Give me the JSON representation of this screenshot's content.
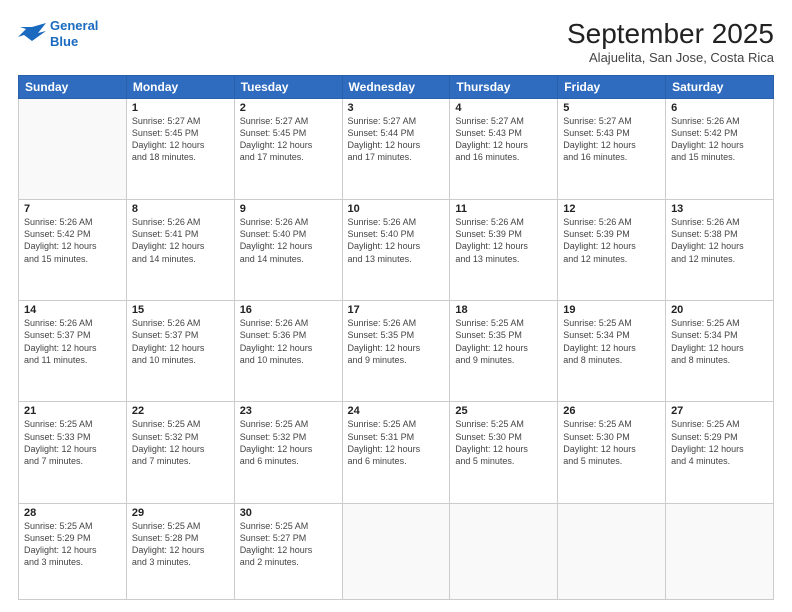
{
  "logo": {
    "line1": "General",
    "line2": "Blue"
  },
  "title": "September 2025",
  "subtitle": "Alajuelita, San Jose, Costa Rica",
  "weekdays": [
    "Sunday",
    "Monday",
    "Tuesday",
    "Wednesday",
    "Thursday",
    "Friday",
    "Saturday"
  ],
  "weeks": [
    [
      {
        "day": "",
        "info": ""
      },
      {
        "day": "1",
        "info": "Sunrise: 5:27 AM\nSunset: 5:45 PM\nDaylight: 12 hours\nand 18 minutes."
      },
      {
        "day": "2",
        "info": "Sunrise: 5:27 AM\nSunset: 5:45 PM\nDaylight: 12 hours\nand 17 minutes."
      },
      {
        "day": "3",
        "info": "Sunrise: 5:27 AM\nSunset: 5:44 PM\nDaylight: 12 hours\nand 17 minutes."
      },
      {
        "day": "4",
        "info": "Sunrise: 5:27 AM\nSunset: 5:43 PM\nDaylight: 12 hours\nand 16 minutes."
      },
      {
        "day": "5",
        "info": "Sunrise: 5:27 AM\nSunset: 5:43 PM\nDaylight: 12 hours\nand 16 minutes."
      },
      {
        "day": "6",
        "info": "Sunrise: 5:26 AM\nSunset: 5:42 PM\nDaylight: 12 hours\nand 15 minutes."
      }
    ],
    [
      {
        "day": "7",
        "info": "Sunrise: 5:26 AM\nSunset: 5:42 PM\nDaylight: 12 hours\nand 15 minutes."
      },
      {
        "day": "8",
        "info": "Sunrise: 5:26 AM\nSunset: 5:41 PM\nDaylight: 12 hours\nand 14 minutes."
      },
      {
        "day": "9",
        "info": "Sunrise: 5:26 AM\nSunset: 5:40 PM\nDaylight: 12 hours\nand 14 minutes."
      },
      {
        "day": "10",
        "info": "Sunrise: 5:26 AM\nSunset: 5:40 PM\nDaylight: 12 hours\nand 13 minutes."
      },
      {
        "day": "11",
        "info": "Sunrise: 5:26 AM\nSunset: 5:39 PM\nDaylight: 12 hours\nand 13 minutes."
      },
      {
        "day": "12",
        "info": "Sunrise: 5:26 AM\nSunset: 5:39 PM\nDaylight: 12 hours\nand 12 minutes."
      },
      {
        "day": "13",
        "info": "Sunrise: 5:26 AM\nSunset: 5:38 PM\nDaylight: 12 hours\nand 12 minutes."
      }
    ],
    [
      {
        "day": "14",
        "info": "Sunrise: 5:26 AM\nSunset: 5:37 PM\nDaylight: 12 hours\nand 11 minutes."
      },
      {
        "day": "15",
        "info": "Sunrise: 5:26 AM\nSunset: 5:37 PM\nDaylight: 12 hours\nand 10 minutes."
      },
      {
        "day": "16",
        "info": "Sunrise: 5:26 AM\nSunset: 5:36 PM\nDaylight: 12 hours\nand 10 minutes."
      },
      {
        "day": "17",
        "info": "Sunrise: 5:26 AM\nSunset: 5:35 PM\nDaylight: 12 hours\nand 9 minutes."
      },
      {
        "day": "18",
        "info": "Sunrise: 5:25 AM\nSunset: 5:35 PM\nDaylight: 12 hours\nand 9 minutes."
      },
      {
        "day": "19",
        "info": "Sunrise: 5:25 AM\nSunset: 5:34 PM\nDaylight: 12 hours\nand 8 minutes."
      },
      {
        "day": "20",
        "info": "Sunrise: 5:25 AM\nSunset: 5:34 PM\nDaylight: 12 hours\nand 8 minutes."
      }
    ],
    [
      {
        "day": "21",
        "info": "Sunrise: 5:25 AM\nSunset: 5:33 PM\nDaylight: 12 hours\nand 7 minutes."
      },
      {
        "day": "22",
        "info": "Sunrise: 5:25 AM\nSunset: 5:32 PM\nDaylight: 12 hours\nand 7 minutes."
      },
      {
        "day": "23",
        "info": "Sunrise: 5:25 AM\nSunset: 5:32 PM\nDaylight: 12 hours\nand 6 minutes."
      },
      {
        "day": "24",
        "info": "Sunrise: 5:25 AM\nSunset: 5:31 PM\nDaylight: 12 hours\nand 6 minutes."
      },
      {
        "day": "25",
        "info": "Sunrise: 5:25 AM\nSunset: 5:30 PM\nDaylight: 12 hours\nand 5 minutes."
      },
      {
        "day": "26",
        "info": "Sunrise: 5:25 AM\nSunset: 5:30 PM\nDaylight: 12 hours\nand 5 minutes."
      },
      {
        "day": "27",
        "info": "Sunrise: 5:25 AM\nSunset: 5:29 PM\nDaylight: 12 hours\nand 4 minutes."
      }
    ],
    [
      {
        "day": "28",
        "info": "Sunrise: 5:25 AM\nSunset: 5:29 PM\nDaylight: 12 hours\nand 3 minutes."
      },
      {
        "day": "29",
        "info": "Sunrise: 5:25 AM\nSunset: 5:28 PM\nDaylight: 12 hours\nand 3 minutes."
      },
      {
        "day": "30",
        "info": "Sunrise: 5:25 AM\nSunset: 5:27 PM\nDaylight: 12 hours\nand 2 minutes."
      },
      {
        "day": "",
        "info": ""
      },
      {
        "day": "",
        "info": ""
      },
      {
        "day": "",
        "info": ""
      },
      {
        "day": "",
        "info": ""
      }
    ]
  ]
}
